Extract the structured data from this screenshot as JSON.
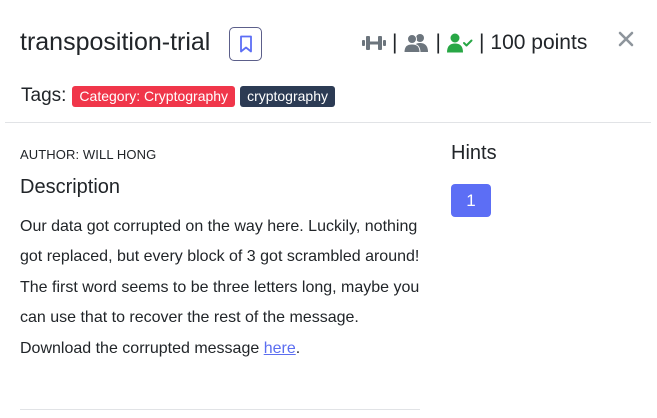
{
  "challenge": {
    "title": "transposition-trial",
    "points_label": "100 points"
  },
  "header_icons": {
    "difficulty": "barbell-icon",
    "solvers": "users-icon",
    "solved": "user-check-icon",
    "bookmark": "bookmark-icon",
    "close": "close-icon",
    "separator": "|"
  },
  "colors": {
    "category_tag": "#f0364a",
    "crypto_tag": "#2c3b54",
    "hint_button": "#5c6ef5",
    "solved_icon": "#28a745",
    "link": "#5c6ef0"
  },
  "tags": {
    "label": "Tags:",
    "items": [
      "Category: Cryptography",
      "cryptography"
    ]
  },
  "author": "AUTHOR: WILL HONG",
  "description": {
    "heading": "Description",
    "text": "Our data got corrupted on the way here. Luckily, nothing got replaced, but every block of 3 got scrambled around! The first word seems to be three letters long, maybe you can use that to recover the rest of the message.",
    "download_prefix": "Download the corrupted message ",
    "download_link": "here",
    "download_suffix": "."
  },
  "hints": {
    "heading": "Hints",
    "items": [
      "1"
    ]
  }
}
